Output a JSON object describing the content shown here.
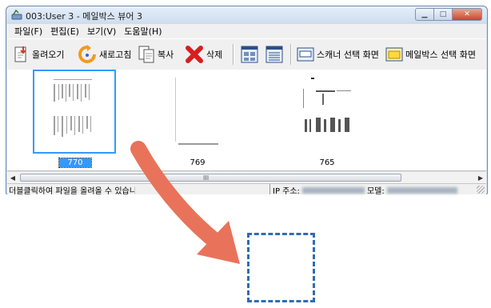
{
  "window": {
    "title": "003:User 3 - 메일박스 뷰어 3",
    "icon": "scanner-app-icon"
  },
  "menu": [
    "파일(F)",
    "편집(E)",
    "보기(V)",
    "도움말(H)"
  ],
  "toolbar": {
    "load_label": "올려오기",
    "refresh_label": "새로고침",
    "copy_label": "복사",
    "delete_label": "삭제",
    "scanner_select_label": "스캐너 선택 화면",
    "mailbox_select_label": "메일박스 선택 화면"
  },
  "thumbnails": [
    {
      "label": "770",
      "selected": true
    },
    {
      "label": "769",
      "selected": false
    },
    {
      "label": "765",
      "selected": false
    }
  ],
  "scrollbar": {
    "grip": "III"
  },
  "status": {
    "hint": "더블클릭하여 파일을 올려올 수 있습니다",
    "ip_label": "IP 주소:",
    "model_label": "모델:"
  },
  "colors": {
    "selection": "#3399ff",
    "arrow": "#e8735a",
    "target_border": "#2f6db3"
  }
}
